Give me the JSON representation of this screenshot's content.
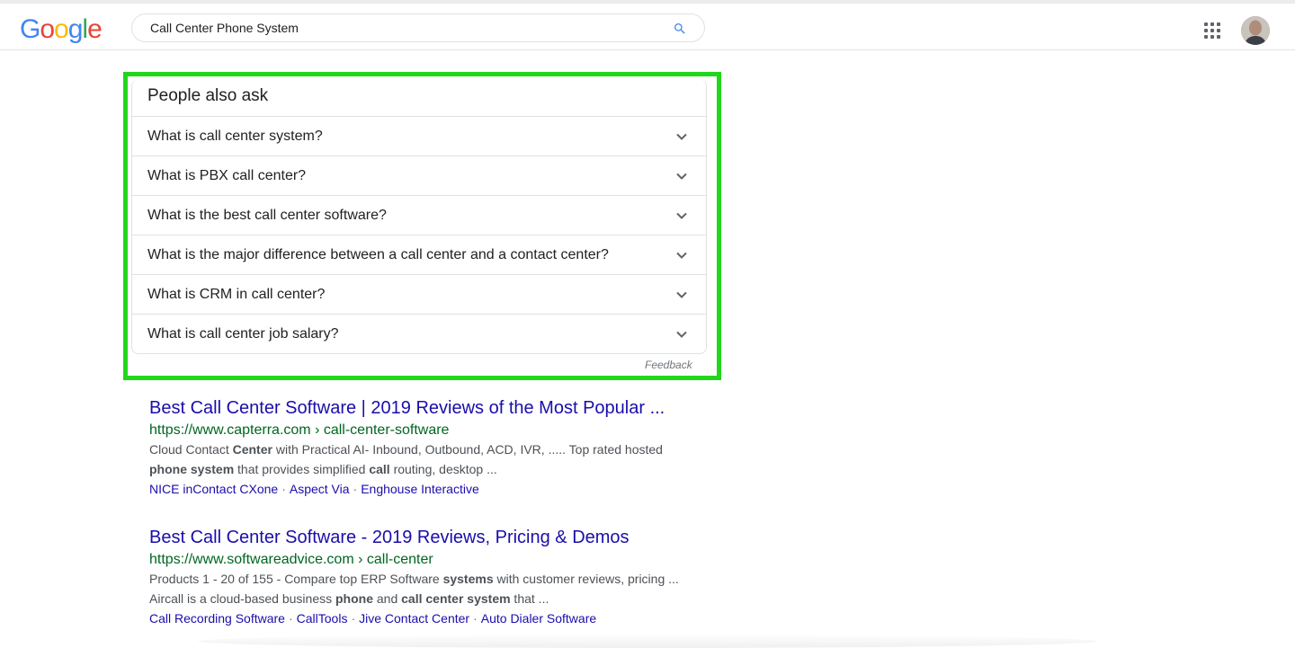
{
  "logo": {
    "letters": [
      "G",
      "o",
      "o",
      "g",
      "l",
      "e"
    ],
    "colors": [
      "#4285F4",
      "#EA4335",
      "#FBBC05",
      "#4285F4",
      "#34A853",
      "#EA4335"
    ]
  },
  "search": {
    "value": "Call Center Phone System"
  },
  "icons": {
    "search": "search-icon",
    "apps": "apps-grid-icon",
    "chevron": "chevron-down-icon"
  },
  "paa": {
    "title": "People also ask",
    "questions": [
      "What is call center system?",
      "What is PBX call center?",
      "What is the best call center software?",
      "What is the major difference between a call center and a contact center?",
      "What is CRM in call center?",
      "What is call center job salary?"
    ],
    "feedback": "Feedback"
  },
  "results": [
    {
      "title": "Best Call Center Software | 2019 Reviews of the Most Popular ...",
      "url": "https://www.capterra.com › call-center-software",
      "snippet_parts": [
        "Cloud Contact ",
        "Center",
        " with Practical AI- Inbound, Outbound, ACD, IVR, ..... Top rated hosted "
      ],
      "snippet2_parts": [
        "phone system",
        " that provides simplified ",
        "call",
        " routing, desktop ..."
      ],
      "links": [
        "NICE inContact CXone",
        "Aspect Via",
        "Enghouse Interactive"
      ]
    },
    {
      "title": "Best Call Center Software - 2019 Reviews, Pricing & Demos",
      "url": "https://www.softwareadvice.com › call-center",
      "snippet_parts": [
        "Products 1 - 20 of 155 - Compare top ERP Software ",
        "systems",
        " with customer reviews, pricing ..."
      ],
      "snippet2_parts": [
        "Aircall is a cloud-based business ",
        "phone",
        " and ",
        "call center system",
        " that ..."
      ],
      "links": [
        "Call Recording Software",
        "CallTools",
        "Jive Contact Center",
        "Auto Dialer Software"
      ]
    }
  ],
  "colors": {
    "highlight": "#21d71c",
    "link": "#1a0dab",
    "url": "#006621"
  }
}
